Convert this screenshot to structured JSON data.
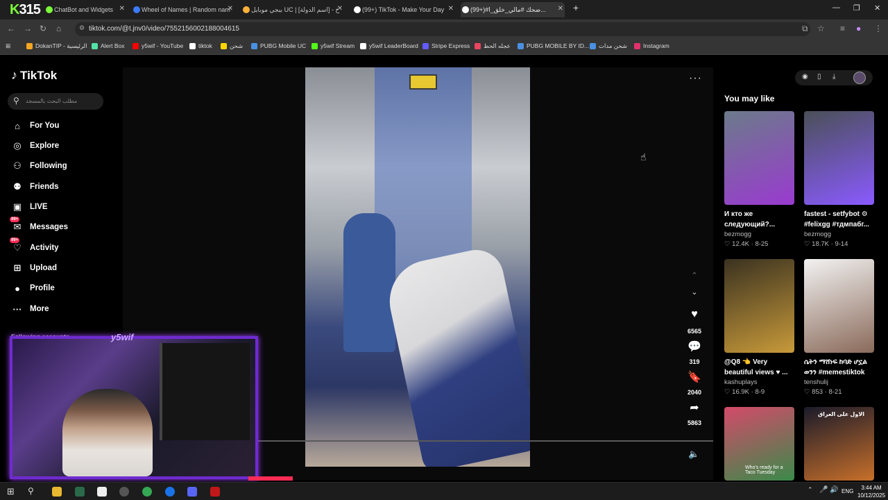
{
  "browser": {
    "badge_logo": "315",
    "tabs": [
      {
        "title": "ChatBot and Widgets",
        "color": "#7bff3a"
      },
      {
        "title": "Wheel of Names | Random nam",
        "color": "#3a7bff"
      },
      {
        "title": "ببجي موبايل UC | [اسم الدولة] - خ",
        "color": "#ffb13a"
      },
      {
        "title": "(99+) TikTok - Make Your Day",
        "color": "#ffffff"
      },
      {
        "title": "(99+)#ضحك #مالي_خلق_ا...",
        "color": "#ffffff"
      }
    ],
    "url": "tiktok.com/@t.jnv0/video/7552156002188004615",
    "bookmarks": [
      {
        "label": "DokanTIP - الرئيسية",
        "color": "#f5a623"
      },
      {
        "label": "Alert Box",
        "color": "#53e3a6"
      },
      {
        "label": "y5wif - YouTube",
        "color": "#ff0000"
      },
      {
        "label": "tiktok",
        "color": "#ffffff"
      },
      {
        "label": "شحن",
        "color": "#ffd700"
      },
      {
        "label": "PUBG Mobile UC",
        "color": "#4a90e2"
      },
      {
        "label": "y5wif Stream",
        "color": "#53fc18"
      },
      {
        "label": "y5wif LeaderBoard",
        "color": "#ffffff"
      },
      {
        "label": "Stripe Express",
        "color": "#635bff"
      },
      {
        "label": "عجله الحظ",
        "color": "#e94560"
      },
      {
        "label": "PUBG MOBILE BY ID...",
        "color": "#4a90e2"
      },
      {
        "label": "شحن مدات",
        "color": "#4a90e2"
      },
      {
        "label": "Instagram",
        "color": "#e1306c"
      }
    ]
  },
  "tiktok": {
    "logo": "TikTok",
    "search_placeholder": "مطلب البحث بالمسجد",
    "nav": [
      {
        "label": "For You",
        "icon": "home-icon",
        "glyph": "⌂"
      },
      {
        "label": "Explore",
        "icon": "compass-icon",
        "glyph": "◎"
      },
      {
        "label": "Following",
        "icon": "following-icon",
        "glyph": "⚇"
      },
      {
        "label": "Friends",
        "icon": "friends-icon",
        "glyph": "⚉"
      },
      {
        "label": "LIVE",
        "icon": "live-icon",
        "glyph": "▣"
      },
      {
        "label": "Messages",
        "icon": "messages-icon",
        "glyph": "✉",
        "badge": "99+"
      },
      {
        "label": "Activity",
        "icon": "activity-icon",
        "glyph": "♡",
        "badge": "99+"
      },
      {
        "label": "Upload",
        "icon": "upload-icon",
        "glyph": "⊞"
      },
      {
        "label": "Profile",
        "icon": "profile-icon",
        "glyph": "●"
      },
      {
        "label": "More",
        "icon": "more-icon",
        "glyph": "···"
      }
    ],
    "following_header": "Following accounts",
    "actions": {
      "likes": "6565",
      "comments": "319",
      "saves": "2040",
      "shares": "5863"
    },
    "you_may_like": "You may like",
    "cards": [
      {
        "title": "И кто же следующий?...",
        "author": "bezmogg",
        "likes": "12.4K",
        "date": "8-25",
        "colors": [
          "#6b7b8a",
          "#9a3ad0"
        ]
      },
      {
        "title": "fastest - setfybot ⚙ #felixgg #тдмпабг...",
        "author": "bezmogg",
        "likes": "18.7K",
        "date": "9-14",
        "colors": [
          "#4a5058",
          "#8a5aff"
        ]
      },
      {
        "title": "@Q8 👈 Very beautiful views ♥ ...",
        "author": "kashuplays",
        "likes": "16.9K",
        "date": "8-9",
        "colors": [
          "#3a3220",
          "#c89a3a"
        ]
      },
      {
        "title": "ሴትን ማሸነፍ ከባድ ሆኗል ወንን #memestiktok",
        "author": "tenshulij",
        "likes": "853",
        "date": "8-21",
        "colors": [
          "#f2f2f2",
          "#8a6a5a"
        ]
      },
      {
        "title": "",
        "author": "",
        "likes": "",
        "date": "",
        "colors": [
          "#d44a6a",
          "#3a8a4a"
        ]
      },
      {
        "title": "",
        "author": "",
        "likes": "",
        "date": "",
        "colors": [
          "#1a1a2a",
          "#c8702a"
        ]
      }
    ],
    "card5_caption": "Who's ready for a Taco Tuesday",
    "card6_caption": "الاول على العراق"
  },
  "stream": {
    "brand": "y5wif"
  },
  "taskbar": {
    "lang": "ENG",
    "time": "3:44 AM",
    "date": "10/12/2025"
  }
}
